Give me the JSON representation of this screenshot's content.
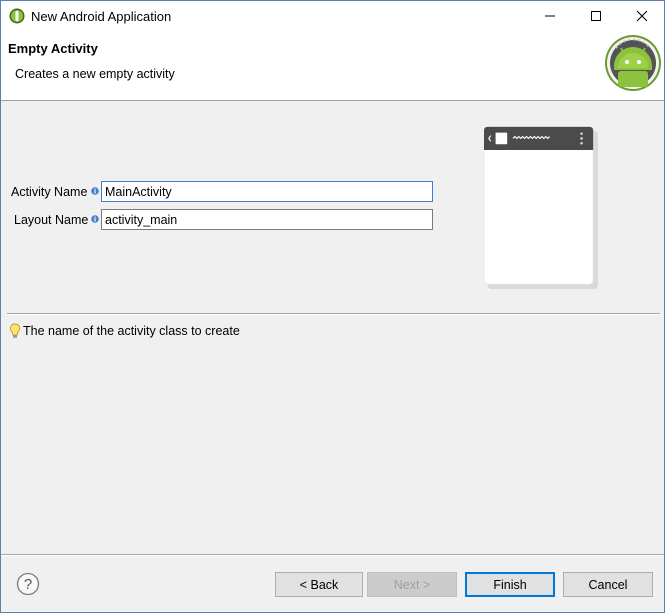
{
  "window": {
    "title": "New Android Application"
  },
  "header": {
    "title": "Empty Activity",
    "description": "Creates a new empty activity"
  },
  "form": {
    "activity_name": {
      "label": "Activity Name",
      "value": "MainActivity"
    },
    "layout_name": {
      "label": "Layout Name",
      "value": "activity_main"
    }
  },
  "hint": {
    "text": "The name of the activity class to create"
  },
  "buttons": {
    "back": "< Back",
    "next": "Next >",
    "finish": "Finish",
    "cancel": "Cancel"
  },
  "colors": {
    "accent": "#0078d7",
    "android_green": "#8dc23f",
    "phone_bar": "#4b4b4b"
  },
  "icons": [
    "android-app-icon",
    "minimize-icon",
    "maximize-icon",
    "close-icon",
    "android-logo-icon",
    "info-icon",
    "lightbulb-icon",
    "help-icon"
  ]
}
